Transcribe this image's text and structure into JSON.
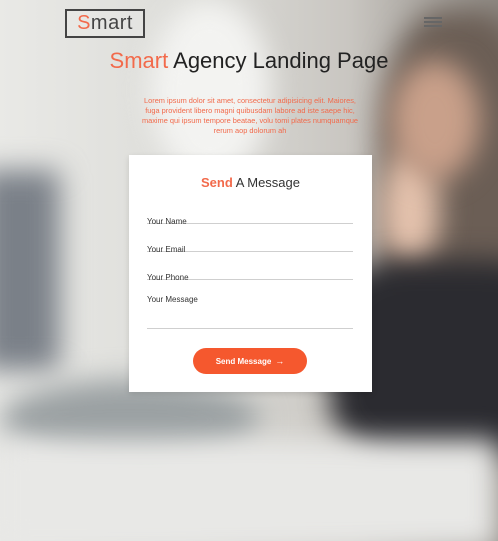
{
  "brand": {
    "logo_first": "S",
    "logo_rest": "mart"
  },
  "hero": {
    "title_accent": "Smart",
    "title_rest": "Agency Landing Page",
    "subtitle": "Lorem ipsum dolor sit amet, consectetur adipisicing elit. Maiores, fuga provident libero magni quibusdam labore ad iste saepe hic, maxime qui ipsum tempore beatae, volu tomi plates numquamque rerum aop dolorum ah"
  },
  "form": {
    "title_accent": "Send",
    "title_rest": "A Message",
    "name_placeholder": "Your Name",
    "email_placeholder": "Your Email",
    "phone_placeholder": "Your Phone",
    "message_placeholder": "Your Message",
    "submit_label": "Send Message",
    "submit_icon": "→"
  },
  "colors": {
    "accent": "#f26a4b",
    "button": "#f5582e"
  },
  "icons": {
    "menu": "hamburger-icon",
    "arrow": "arrow-right-icon"
  }
}
